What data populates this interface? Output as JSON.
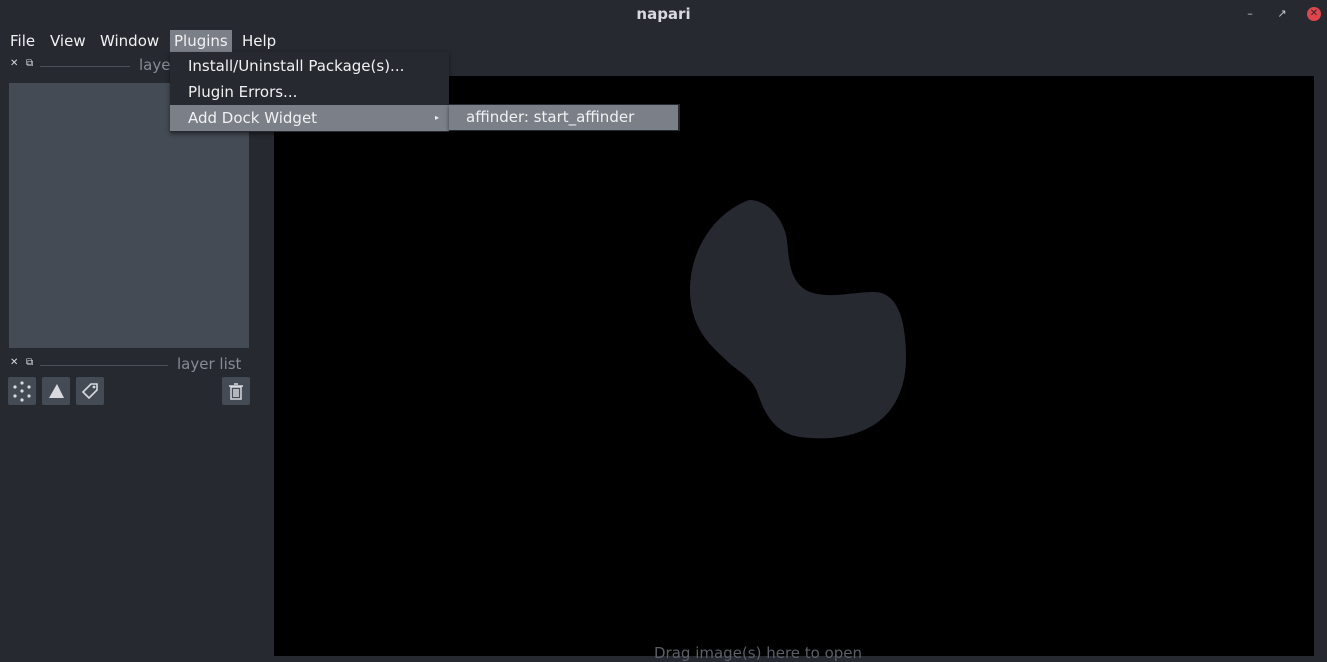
{
  "window": {
    "title": "napari"
  },
  "menubar": {
    "items": [
      {
        "label": "File"
      },
      {
        "label": "View"
      },
      {
        "label": "Window"
      },
      {
        "label": "Plugins"
      },
      {
        "label": "Help"
      }
    ]
  },
  "plugins_menu": {
    "items": [
      {
        "label": "Install/Uninstall Package(s)..."
      },
      {
        "label": "Plugin Errors..."
      },
      {
        "label": "Add Dock Widget"
      }
    ],
    "submenu": {
      "items": [
        {
          "label": "affinder: start_affinder"
        }
      ]
    }
  },
  "docks": {
    "top": {
      "title": "layer controls",
      "visible_title": "laye"
    },
    "bottom": {
      "title": "layer list"
    }
  },
  "layer_buttons": [
    "new-points-icon",
    "new-shapes-icon",
    "new-labels-icon",
    "delete-layer-icon"
  ],
  "canvas": {
    "bottom_text": "Drag image(s) here to open"
  },
  "colors": {
    "background": "#262930",
    "highlight": "#7b7f87",
    "panel": "#444b54",
    "canvas": "#000000",
    "close": "#e0454b"
  }
}
